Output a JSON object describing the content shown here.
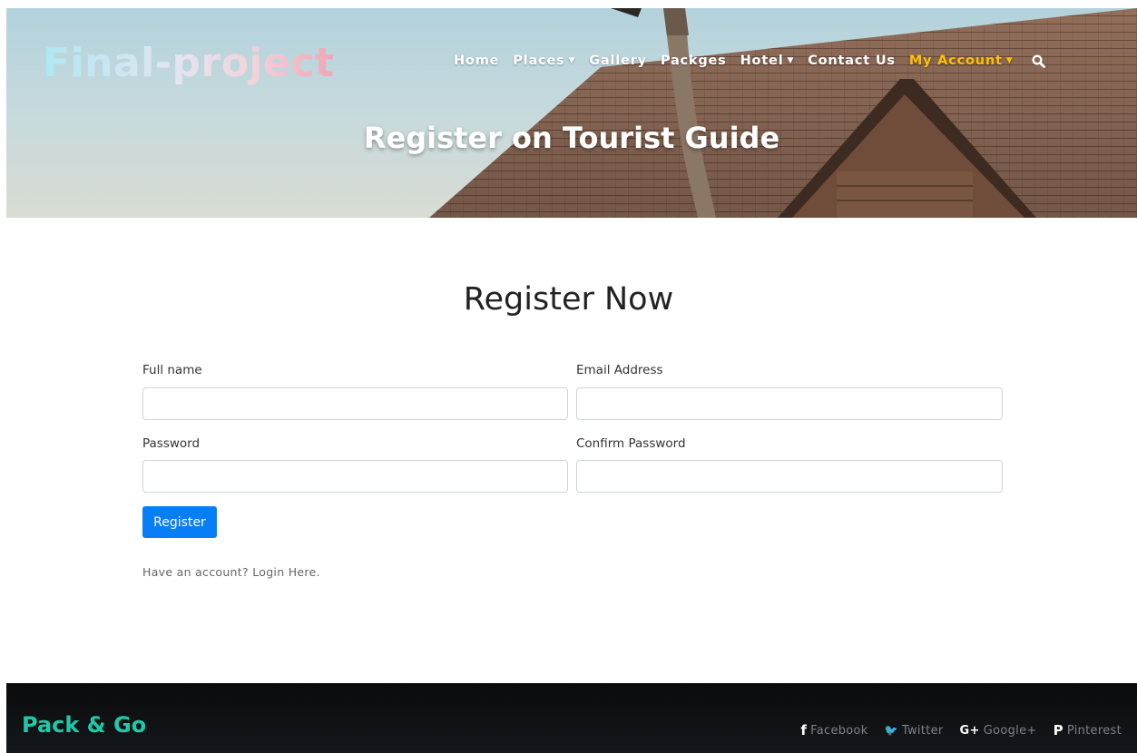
{
  "header": {
    "logo": "Final-project",
    "nav": [
      {
        "label": "Home",
        "caret": ""
      },
      {
        "label": "Places",
        "caret": "▼"
      },
      {
        "label": "Gallery",
        "caret": ""
      },
      {
        "label": "Packges",
        "caret": ""
      },
      {
        "label": "Hotel",
        "caret": "▼"
      },
      {
        "label": "Contact Us",
        "caret": ""
      },
      {
        "label": "My Account",
        "caret": "▼"
      }
    ],
    "search_icon": "search-icon",
    "hero_title": "Register on Tourist Guide"
  },
  "form": {
    "title": "Register Now",
    "full_name_label": "Full name",
    "full_name_value": "",
    "email_label": "Email Address",
    "email_value": "",
    "password_label": "Password",
    "password_value": "",
    "confirm_password_label": "Confirm Password",
    "confirm_password_value": "",
    "register_label": "Register",
    "login_prompt": "Have an account?",
    "login_link": "Login Here."
  },
  "footer": {
    "brand": "Pack & Go",
    "social": [
      {
        "icon": "f",
        "label": "Facebook"
      },
      {
        "icon": "🐦",
        "label": "Twitter"
      },
      {
        "icon": "G+",
        "label": "Google+"
      },
      {
        "icon": "P",
        "label": "Pinterest"
      }
    ]
  },
  "colors": {
    "accent": "#ffc100",
    "primary_button": "#087ef6",
    "brand": "#1fc9a8",
    "footer_bg": "#0b0b0b"
  }
}
